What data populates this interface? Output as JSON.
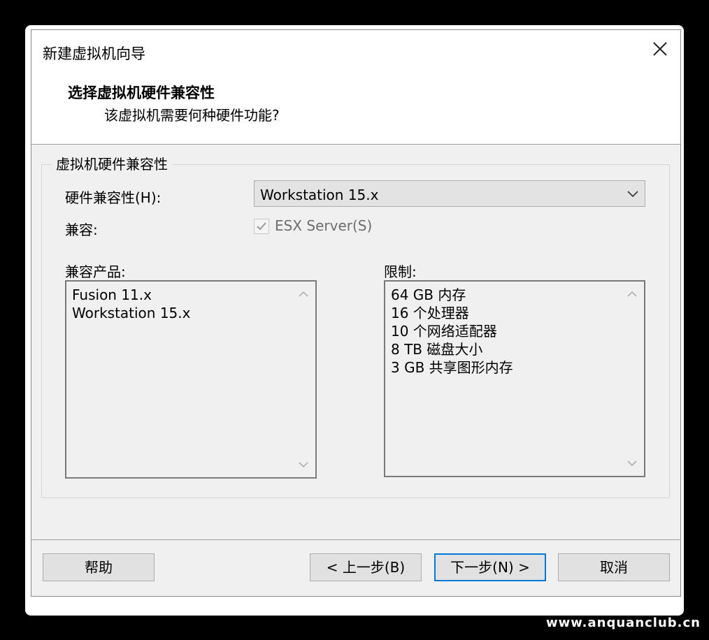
{
  "window": {
    "title": "新建虚拟机向导",
    "heading": "选择虚拟机硬件兼容性",
    "subheading": "该虚拟机需要何种硬件功能?"
  },
  "group": {
    "legend": "虚拟机硬件兼容性",
    "hardware_compat_label": "硬件兼容性(H):",
    "hardware_compat_value": "Workstation 15.x",
    "compat_label": "兼容:",
    "esx_checkbox_label": "ESX Server(S)",
    "esx_checked": true,
    "esx_enabled": false,
    "products_label": "兼容产品:",
    "products": [
      "Fusion 11.x",
      "Workstation 15.x"
    ],
    "limits_label": "限制:",
    "limits": [
      "64 GB 内存",
      "16 个处理器",
      "10 个网络适配器",
      "8 TB 磁盘大小",
      "3 GB 共享图形内存"
    ]
  },
  "buttons": {
    "help": "帮助",
    "back": "< 上一步(B)",
    "next": "下一步(N) >",
    "cancel": "取消"
  },
  "watermark": "www.anquanclub.cn",
  "icons": {
    "close": "close-icon",
    "dropdown": "chevron-down-icon",
    "check": "checkmark-icon"
  },
  "colors": {
    "accent": "#0078d7",
    "dialog_bg": "#f0f0f0",
    "disabled_text": "#6d6d6d"
  }
}
